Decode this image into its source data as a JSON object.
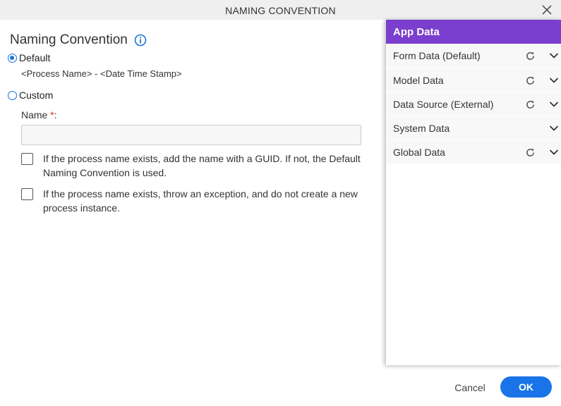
{
  "dialog": {
    "title": "NAMING CONVENTION"
  },
  "form": {
    "heading": "Naming Convention",
    "default_option": {
      "label": "Default",
      "checked": true,
      "value_text": "<Process Name> - <Date Time Stamp>"
    },
    "custom_option": {
      "label": "Custom",
      "checked": false
    },
    "name_field": {
      "label": "Name",
      "required_mark": "*",
      "label_suffix": ":",
      "value": "",
      "placeholder": ""
    },
    "checkboxes": [
      {
        "label": "If the process name exists, add the name with a GUID. If not, the Default Naming Convention is used.",
        "checked": false
      },
      {
        "label": "If the process name exists, throw an exception, and do not create a new process instance.",
        "checked": false
      }
    ]
  },
  "app_data": {
    "title": "App Data",
    "items": [
      {
        "label": "Form Data (Default)",
        "refresh": true
      },
      {
        "label": "Model Data",
        "refresh": true
      },
      {
        "label": "Data Source (External)",
        "refresh": true
      },
      {
        "label": "System Data",
        "refresh": false
      },
      {
        "label": "Global Data",
        "refresh": true
      }
    ]
  },
  "footer": {
    "cancel_label": "Cancel",
    "ok_label": "OK"
  },
  "colors": {
    "accent": "#1a73e8",
    "panel_header": "#7a3fce",
    "required": "#d32f2f"
  },
  "icons": {
    "close": "close-icon",
    "info": "info-icon",
    "refresh": "refresh-icon",
    "expand": "chevron-down-icon"
  }
}
